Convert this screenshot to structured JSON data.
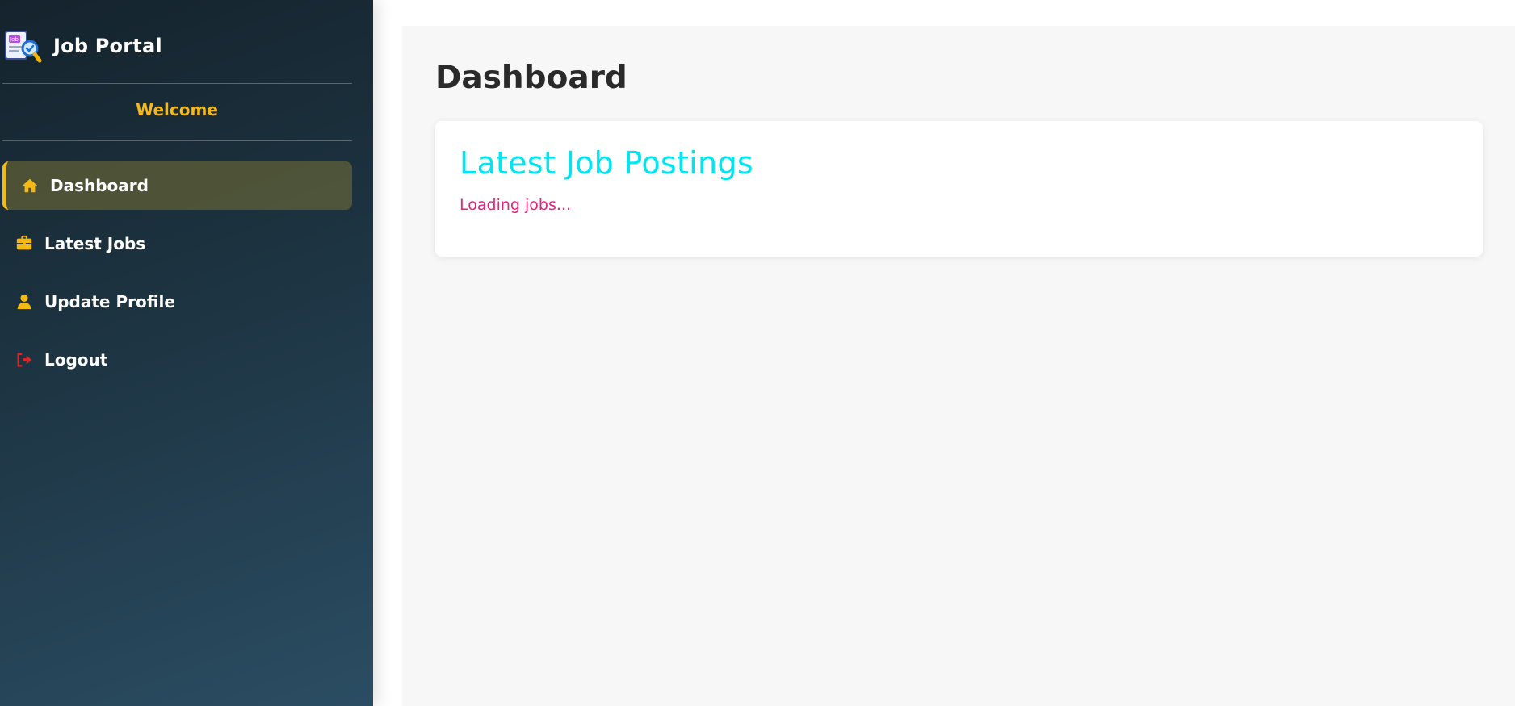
{
  "brand": {
    "title": "Job Portal",
    "logo_text": "Job"
  },
  "sidebar": {
    "welcome": "Welcome",
    "items": [
      {
        "label": "Dashboard",
        "icon": "home-icon",
        "active": true
      },
      {
        "label": "Latest Jobs",
        "icon": "briefcase-icon",
        "active": false
      },
      {
        "label": "Update Profile",
        "icon": "user-icon",
        "active": false
      },
      {
        "label": "Logout",
        "icon": "logout-icon",
        "active": false
      }
    ]
  },
  "main": {
    "title": "Dashboard",
    "card": {
      "title": "Latest Job Postings",
      "status": "Loading jobs..."
    }
  },
  "colors": {
    "accent": "#f5b915",
    "card_title": "#00e5f0",
    "loading_text": "#e2207d",
    "logout_icon": "#e02424"
  }
}
